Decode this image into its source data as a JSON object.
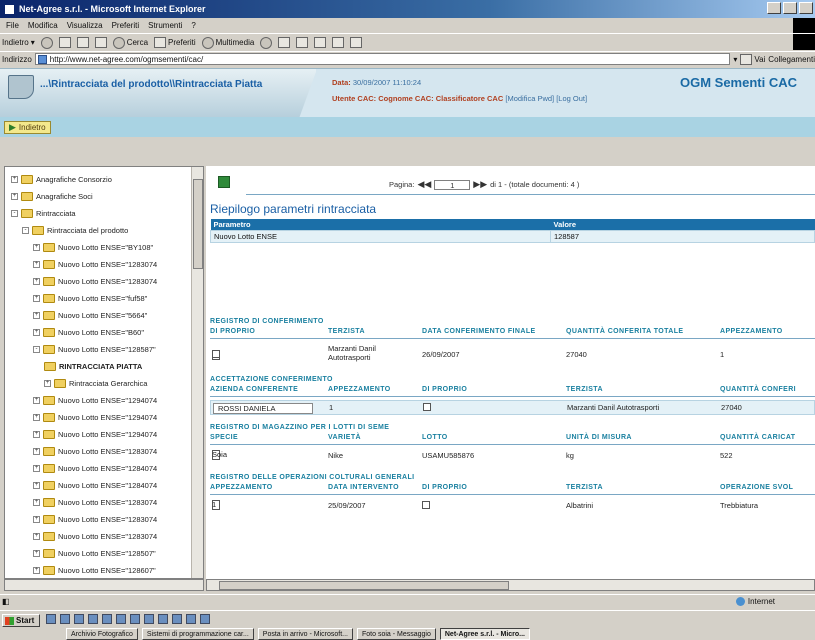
{
  "window": {
    "title": "Net-Agree s.r.l. - Microsoft Internet Explorer"
  },
  "menu": [
    "File",
    "Modifica",
    "Visualizza",
    "Preferiti",
    "Strumenti",
    "?"
  ],
  "toolbar": {
    "back": "Indietro",
    "search": "Cerca",
    "favorites": "Preferiti",
    "multimedia": "Multimedia"
  },
  "address": {
    "label": "Indirizzo",
    "url": "http://www.net-agree.com/ogmsementi/cac/",
    "go": "Vai",
    "links": "Collegamenti"
  },
  "app": {
    "breadcrumb": "...\\Rintracciata del prodotto\\\\Rintracciata Piatta",
    "date_label": "Data:",
    "date_value": "30/09/2007 11:10:24",
    "user_line": "Utente CAC: Cognome CAC: Classificatore CAC",
    "actions": "[Modifica Pwd] [Log Out]",
    "brand": "OGM Sementi CAC",
    "back_button": "Indietro"
  },
  "tree": {
    "items": [
      {
        "label": "Anagrafiche Consorzio",
        "level": 0,
        "expand": "+"
      },
      {
        "label": "Anagrafiche Soci",
        "level": 0,
        "expand": "+"
      },
      {
        "label": "Rintracciata",
        "level": 0,
        "expand": "-"
      },
      {
        "label": "Rintracciata del prodotto",
        "level": 1,
        "expand": "-"
      },
      {
        "label": "Nuovo Lotto ENSE=\"BY108\"",
        "level": 2,
        "expand": "+"
      },
      {
        "label": "Nuovo Lotto ENSE=\"1283074",
        "level": 2,
        "expand": "+"
      },
      {
        "label": "Nuovo Lotto ENSE=\"1283074",
        "level": 2,
        "expand": "+"
      },
      {
        "label": "Nuovo Lotto ENSE=\"fuf58\"",
        "level": 2,
        "expand": "+"
      },
      {
        "label": "Nuovo Lotto ENSE=\"5664\"",
        "level": 2,
        "expand": "+"
      },
      {
        "label": "Nuovo Lotto ENSE=\"B60\"",
        "level": 2,
        "expand": "+"
      },
      {
        "label": "Nuovo Lotto ENSE=\"128587\"",
        "level": 2,
        "expand": "-"
      },
      {
        "label": "RINTRACCIATA PIATTA",
        "level": 3,
        "expand": "",
        "bold": true
      },
      {
        "label": "Rintracciata Gerarchica",
        "level": 3,
        "expand": "+"
      },
      {
        "label": "Nuovo Lotto ENSE=\"1294074",
        "level": 2,
        "expand": "+"
      },
      {
        "label": "Nuovo Lotto ENSE=\"1294074",
        "level": 2,
        "expand": "+"
      },
      {
        "label": "Nuovo Lotto ENSE=\"1294074",
        "level": 2,
        "expand": "+"
      },
      {
        "label": "Nuovo Lotto ENSE=\"1283074",
        "level": 2,
        "expand": "+"
      },
      {
        "label": "Nuovo Lotto ENSE=\"1284074",
        "level": 2,
        "expand": "+"
      },
      {
        "label": "Nuovo Lotto ENSE=\"1284074",
        "level": 2,
        "expand": "+"
      },
      {
        "label": "Nuovo Lotto ENSE=\"1283074",
        "level": 2,
        "expand": "+"
      },
      {
        "label": "Nuovo Lotto ENSE=\"1283074",
        "level": 2,
        "expand": "+"
      },
      {
        "label": "Nuovo Lotto ENSE=\"1283074",
        "level": 2,
        "expand": "+"
      },
      {
        "label": "Nuovo Lotto ENSE=\"128507\"",
        "level": 2,
        "expand": "+"
      },
      {
        "label": "Nuovo Lotto ENSE=\"128607\"",
        "level": 2,
        "expand": "+"
      }
    ]
  },
  "pager": {
    "label": "Pagina:",
    "current": "1",
    "suffix": "di 1 - (totale documenti: 4 )"
  },
  "summary": {
    "title": "Riepilogo parametri rintracciata",
    "headers": [
      "Parametro",
      "Valore"
    ],
    "row": [
      "Nuovo Lotto ENSE",
      "128587"
    ]
  },
  "conferimento": {
    "title": "REGISTRO DI CONFERIMENTO",
    "headers": [
      "DI PROPRIO",
      "TERZISTA",
      "DATA CONFERIMENTO FINALE",
      "QUANTITÀ CONFERITA TOTALE",
      "APPEZZAMENTO"
    ],
    "row": [
      "Marzanti Danil Autotrasporti",
      "26/09/2007",
      "27040",
      "1"
    ]
  },
  "accettazione": {
    "title": "ACCETTAZIONE CONFERIMENTO",
    "headers": [
      "AZIENDA CONFERENTE",
      "APPEZZAMENTO",
      "DI PROPRIO",
      "TERZISTA",
      "QUANTITÀ CONFERI"
    ],
    "row": [
      "ROSSI DANIELA",
      "1",
      "Marzanti Danil Autotrasporti",
      "27040"
    ]
  },
  "magazzino": {
    "title": "REGISTRO DI MAGAZZINO PER I LOTTI DI SEME",
    "headers": [
      "SPECIE",
      "VARIETÀ",
      "LOTTO",
      "UNITÀ DI MISURA",
      "QUANTITÀ CARICAT"
    ],
    "row": [
      "Soia",
      "Nike",
      "USAMU585876",
      "kg",
      "522"
    ]
  },
  "operazioni": {
    "title": "REGISTRO DELLE OPERAZIONI COLTURALI GENERALI",
    "headers": [
      "APPEZZAMENTO",
      "DATA INTERVENTO",
      "DI PROPRIO",
      "TERZISTA",
      "OPERAZIONE SVOL"
    ],
    "row": [
      "1",
      "25/09/2007",
      "Albatrini",
      "Trebbiatura"
    ]
  },
  "status": {
    "zone": "Internet"
  },
  "taskbar": {
    "start": "Start",
    "buttons": [
      "Archivio Fotografico",
      "Sistemi di programmazione car...",
      "Posta in arrivo - Microsoft...",
      "Foto soia - Messaggio",
      "Net-Agree s.r.l. - Micro..."
    ]
  }
}
